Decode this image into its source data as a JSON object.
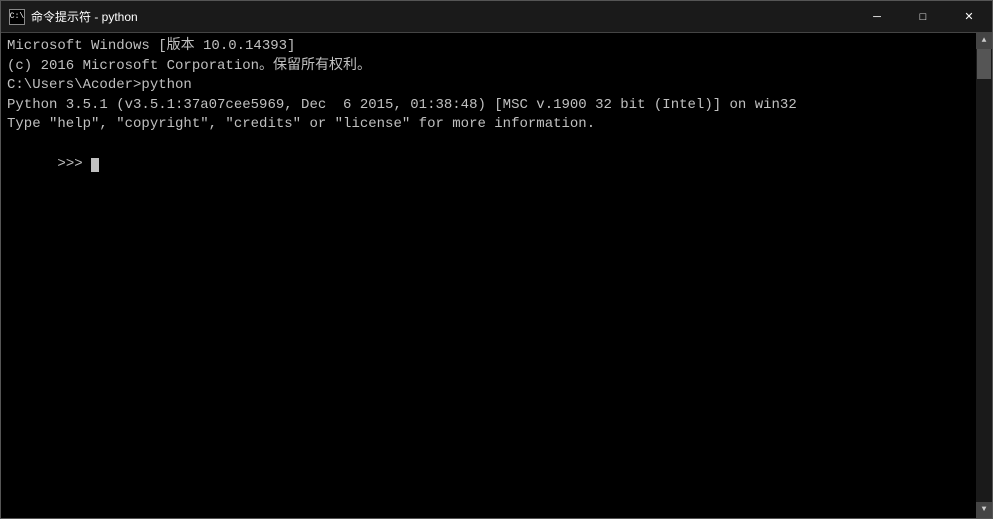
{
  "window": {
    "title_icon": "▶",
    "title_text": "命令提示符 - python",
    "app_name": "命令提示符 - python"
  },
  "controls": {
    "minimize": "─",
    "maximize": "□",
    "close": "✕"
  },
  "console": {
    "line1": "Microsoft Windows [版本 10.0.14393]",
    "line2": "(c) 2016 Microsoft Corporation。保留所有权利。",
    "line3": "",
    "line4": "C:\\Users\\Acoder>python",
    "line5": "Python 3.5.1 (v3.5.1:37a07cee5969, Dec  6 2015, 01:38:48) [MSC v.1900 32 bit (Intel)] on win32",
    "line6": "Type \"help\", \"copyright\", \"credits\" or \"license\" for more information.",
    "line7": ">>> "
  }
}
